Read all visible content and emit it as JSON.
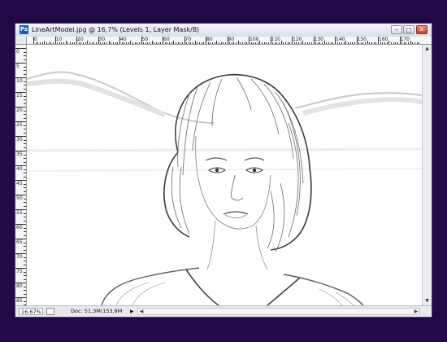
{
  "window": {
    "title": "LineArtModel.jpg @ 16,7% (Levels 1, Layer Mask/8)",
    "app_icon": "Ps",
    "minimize_glyph": "–",
    "maximize_glyph": "□",
    "close_glyph": "✕"
  },
  "ruler": {
    "top_labels": [
      "0",
      "10",
      "20",
      "30",
      "40",
      "50",
      "60",
      "70",
      "80",
      "90",
      "100",
      "110",
      "120",
      "130",
      "140",
      "150",
      "160",
      "170"
    ],
    "left_labels": [
      "0",
      "5",
      "10",
      "15",
      "20",
      "25",
      "30",
      "35",
      "40",
      "45",
      "50",
      "55",
      "60",
      "65",
      "70",
      "75",
      "80",
      "85"
    ]
  },
  "canvas": {
    "image_description_icon": "line-art-portrait-image"
  },
  "status": {
    "zoom": "16.67%",
    "doc_info": "Doc: 51,3M/153,8M",
    "arrow_glyph": "▶",
    "scroll_left": "◀",
    "scroll_right": "▶",
    "scroll_up": "▲",
    "scroll_down": "▼"
  },
  "colors": {
    "background": "#1f0a45",
    "titlebar": "#dfe5ef",
    "canvas": "#ffffff"
  }
}
